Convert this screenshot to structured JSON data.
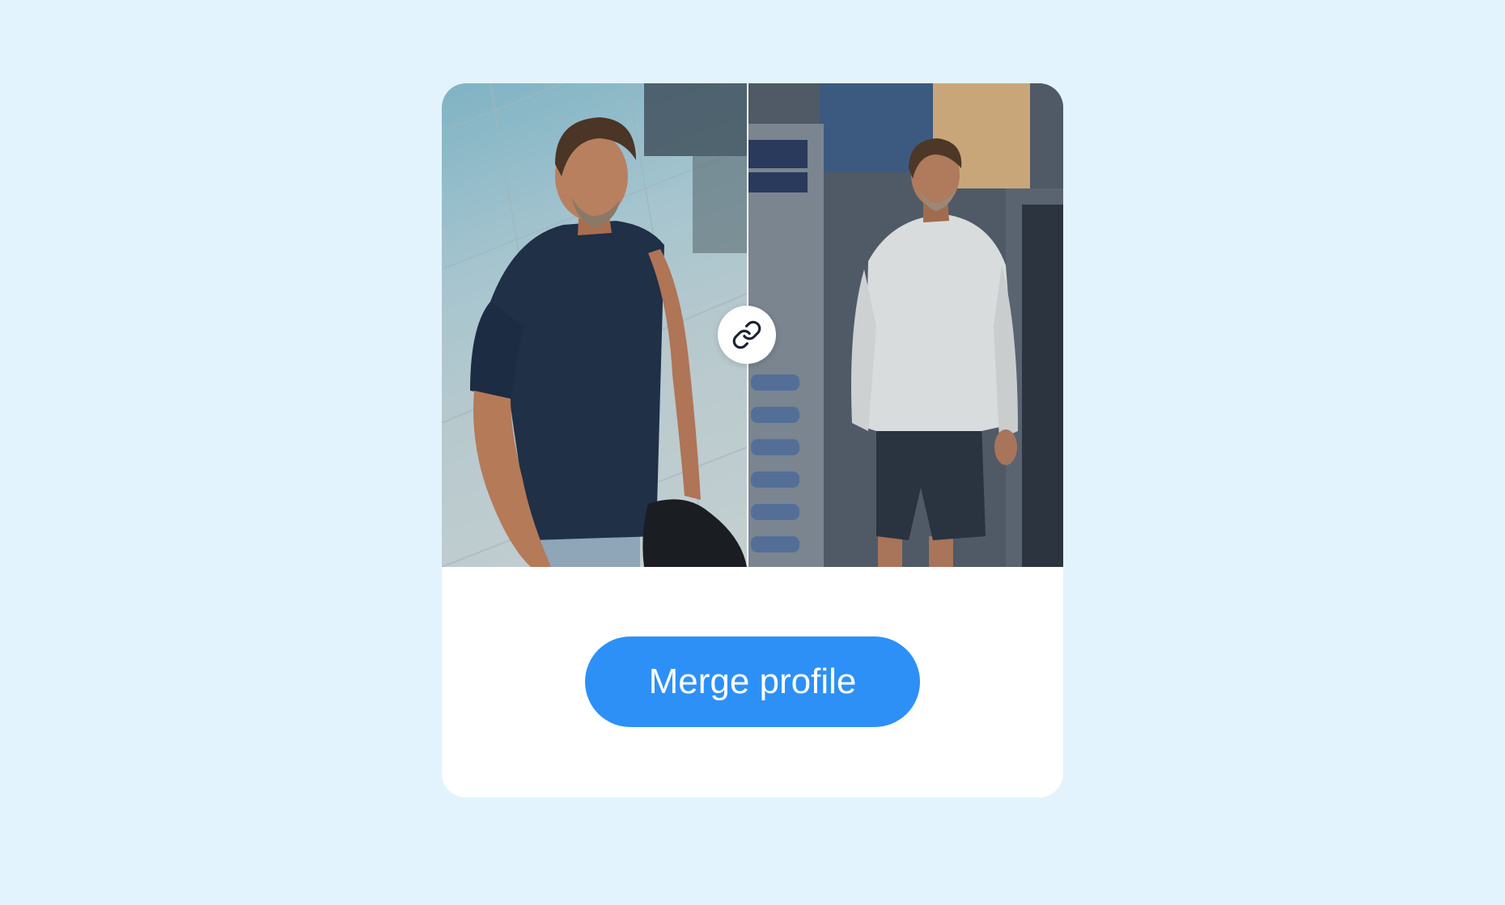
{
  "card": {
    "photos": [
      {
        "name": "left-photo",
        "description_icon": "person-photo"
      },
      {
        "name": "right-photo",
        "description_icon": "person-photo"
      }
    ],
    "link_icon": "link-icon"
  },
  "merge_button": {
    "label": "Merge profile"
  },
  "colors": {
    "background": "#e3f3fe",
    "card": "#ffffff",
    "button": "#2d90f7",
    "button_text": "#ffffff",
    "icon": "#1a2233"
  }
}
